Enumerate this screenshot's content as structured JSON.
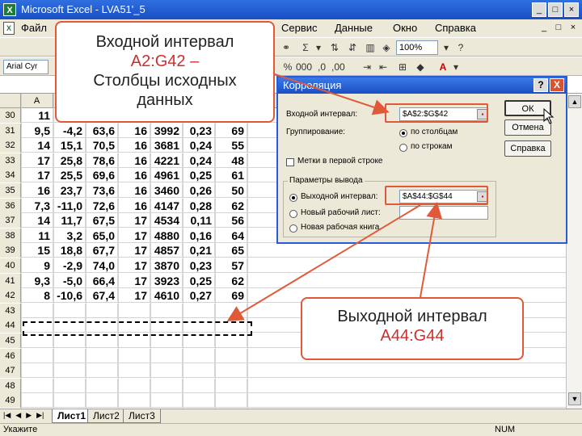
{
  "window": {
    "title": "Microsoft Excel - LVA51'_5",
    "buttons": [
      "_",
      "□",
      "×"
    ]
  },
  "menu": {
    "items": [
      {
        "label": "Файл"
      },
      {
        "label": "Сервис"
      },
      {
        "label": "Данные"
      },
      {
        "label": "Окно"
      },
      {
        "label": "Справка"
      }
    ],
    "doc_buttons": [
      "_",
      "□",
      "×"
    ]
  },
  "toolbar": {
    "zoom": "100%",
    "font_name": "Arial Cyr"
  },
  "sheet": {
    "col_headers": [
      "A"
    ],
    "rows": [
      {
        "num": "30",
        "cells": [
          "11",
          "",
          "",
          "",
          "",
          "",
          ""
        ]
      },
      {
        "num": "31",
        "cells": [
          "9,5",
          "-4,2",
          "63,6",
          "16",
          "3992",
          "0,23",
          "69"
        ]
      },
      {
        "num": "32",
        "cells": [
          "14",
          "15,1",
          "70,5",
          "16",
          "3681",
          "0,24",
          "55"
        ]
      },
      {
        "num": "33",
        "cells": [
          "17",
          "25,8",
          "78,6",
          "16",
          "4221",
          "0,24",
          "48"
        ]
      },
      {
        "num": "34",
        "cells": [
          "17",
          "25,5",
          "69,6",
          "16",
          "4961",
          "0,25",
          "61"
        ]
      },
      {
        "num": "35",
        "cells": [
          "16",
          "23,7",
          "73,6",
          "16",
          "3460",
          "0,26",
          "50"
        ]
      },
      {
        "num": "36",
        "cells": [
          "7,3",
          "-11,0",
          "72,6",
          "16",
          "4147",
          "0,28",
          "62"
        ]
      },
      {
        "num": "37",
        "cells": [
          "14",
          "11,7",
          "67,5",
          "17",
          "4534",
          "0,11",
          "56"
        ]
      },
      {
        "num": "38",
        "cells": [
          "11",
          "3,2",
          "65,0",
          "17",
          "4880",
          "0,16",
          "64"
        ]
      },
      {
        "num": "39",
        "cells": [
          "15",
          "18,8",
          "67,7",
          "17",
          "4857",
          "0,21",
          "65"
        ]
      },
      {
        "num": "40",
        "cells": [
          "9",
          "-2,9",
          "74,0",
          "17",
          "3870",
          "0,23",
          "57"
        ]
      },
      {
        "num": "41",
        "cells": [
          "9,3",
          "-5,0",
          "66,4",
          "17",
          "3923",
          "0,25",
          "62"
        ]
      },
      {
        "num": "42",
        "cells": [
          "8",
          "-10,6",
          "67,4",
          "17",
          "4610",
          "0,27",
          "69"
        ]
      },
      {
        "num": "43",
        "cells": [
          "",
          "",
          "",
          "",
          "",
          "",
          ""
        ]
      },
      {
        "num": "44",
        "cells": [
          "",
          "",
          "",
          "",
          "",
          "",
          ""
        ]
      },
      {
        "num": "45",
        "cells": [
          "",
          "",
          "",
          "",
          "",
          "",
          ""
        ]
      },
      {
        "num": "46",
        "cells": [
          "",
          "",
          "",
          "",
          "",
          "",
          ""
        ]
      },
      {
        "num": "47",
        "cells": [
          "",
          "",
          "",
          "",
          "",
          "",
          ""
        ]
      },
      {
        "num": "48",
        "cells": [
          "",
          "",
          "",
          "",
          "",
          "",
          ""
        ]
      },
      {
        "num": "49",
        "cells": [
          "",
          "",
          "",
          "",
          "",
          "",
          ""
        ]
      }
    ],
    "tabs": [
      {
        "label": "Лист1",
        "active": true
      },
      {
        "label": "Лист2",
        "active": false
      },
      {
        "label": "Лист3",
        "active": false
      }
    ]
  },
  "status": {
    "text": "Укажите",
    "num": "NUM"
  },
  "dialog": {
    "title": "Корреляция",
    "input_range_label": "Входной интервал:",
    "input_range_value": "$A$2:$G$42",
    "grouping_label": "Группирование:",
    "by_columns": "по столбцам",
    "by_rows": "по строкам",
    "labels_first_row": "Метки в первой строке",
    "output_group": "Параметры вывода",
    "output_range_label": "Выходной интервал:",
    "output_range_value": "$A$44:$G$44",
    "new_sheet": "Новый рабочий лист:",
    "new_book": "Новая рабочая книга",
    "ok": "ОК",
    "cancel": "Отмена",
    "help": "Справка",
    "help_btn": "?",
    "close_btn": "X"
  },
  "callouts": {
    "input": {
      "line1": "Входной интервал",
      "line2": "A2:G42 –",
      "line3": "Столбцы исходных",
      "line4": "данных"
    },
    "output": {
      "line1": "Выходной интервал",
      "line2": "A44:G44"
    }
  },
  "colors": {
    "callout_border": "#e05a3a",
    "title_blue": "#1a4fc4"
  }
}
